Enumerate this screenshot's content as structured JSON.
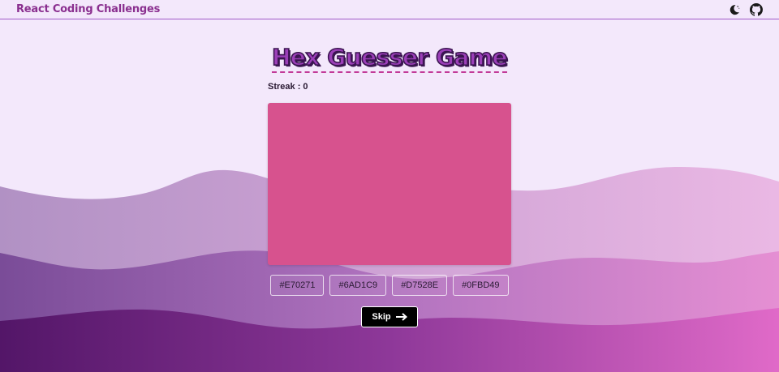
{
  "navbar": {
    "brand": "React Coding Challenges",
    "icons": [
      "moon-icon",
      "github-icon"
    ]
  },
  "game": {
    "title": "Hex Guesser Game",
    "streak_label": "Streak : 0",
    "target_color": "#D7528E",
    "options": [
      "#E70271",
      "#6AD1C9",
      "#D7528E",
      "#0FBD49"
    ],
    "skip_label": "Skip"
  },
  "colors": {
    "background": "#f3e8fb",
    "brand": "#8a2f8f",
    "title_fill": "#9b3fb8",
    "title_outline": "#3a1450",
    "title_underline": "#c23a98",
    "navbar_border": "#a05ac8"
  }
}
